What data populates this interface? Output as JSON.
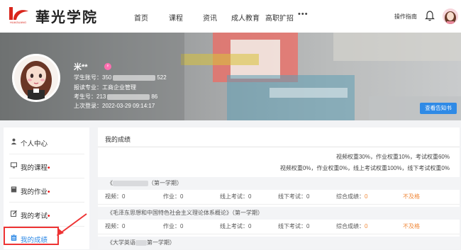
{
  "header": {
    "brand": "華光学院",
    "nav": [
      "首页",
      "课程",
      "资讯",
      "成人教育",
      "高职扩招"
    ],
    "more": "•••",
    "guide": "操作指南",
    "icons": [
      "logo-icon",
      "bell-icon",
      "avatar-icon"
    ]
  },
  "profile": {
    "name": "米**",
    "student_no_label": "学生账号：",
    "student_no_prefix": "350",
    "student_no_suffix": "522",
    "major": "报读专业：工商企业管理",
    "exam_no_label": "考生号：",
    "exam_no_prefix": "213",
    "exam_no_suffix": "86",
    "last_login": "上次登录：2022-03-29 09:14:17",
    "notice_button": "查看告知书"
  },
  "sidebar": {
    "items": [
      {
        "label": "个人中心",
        "icon": "user-icon",
        "dot": ""
      },
      {
        "label": "我的课程",
        "icon": "monitor-icon",
        "dot": "•"
      },
      {
        "label": "我的作业",
        "icon": "book-icon",
        "dot": "•"
      },
      {
        "label": "我的考试",
        "icon": "edit-icon",
        "dot": "•"
      },
      {
        "label": "我的成绩",
        "icon": "clipboard-icon",
        "dot": ""
      }
    ]
  },
  "main": {
    "title": "我的成绩",
    "weights_line1": "视频权重30%，作业权重10%，考试权重60%",
    "weights_line2": "视频权重0%，作业权重0%，线上考试权重100%，线下考试权重0%",
    "labels": {
      "video": "视频：",
      "homework": "作业：",
      "online": "线上考试：",
      "offline": "线下考试：",
      "total": "综合成绩："
    },
    "courses": [
      {
        "name_suffix": "（第一学期）",
        "name_prefix": "《",
        "video": "0",
        "homework": "0",
        "online": "0",
        "offline": "0",
        "total": "0",
        "status": "不及格"
      },
      {
        "name_prefix": "《毛泽东思想和中国特色社会主义理论体系概论》",
        "name_suffix": "（第一学期）",
        "video": "0",
        "homework": "0",
        "online": "0",
        "offline": "0",
        "total": "0",
        "status": "不及格"
      },
      {
        "name_prefix": "《大学英语",
        "name_suffix": "第一学期）"
      }
    ]
  },
  "colors": {
    "accent": "#2f8ae6",
    "alert": "#e33333",
    "warn": "#f08a3c"
  }
}
